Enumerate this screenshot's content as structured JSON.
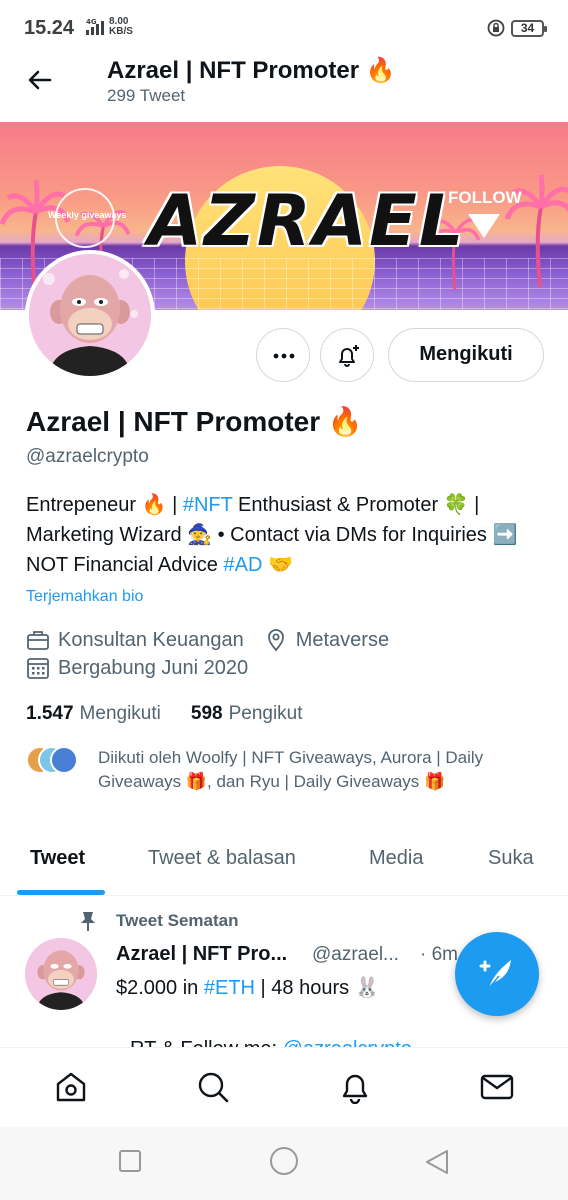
{
  "status_bar": {
    "time": "15.24",
    "network": "4G",
    "speed_value": "8.00",
    "speed_unit": "KB/S",
    "battery": "34"
  },
  "header": {
    "title": "Azrael | NFT Promoter 🔥",
    "tweet_count": "299 Tweet"
  },
  "banner": {
    "title": "AZRAEL",
    "badge_text": "Weekly giveaways",
    "follow_text": "FOLLOW"
  },
  "actions": {
    "follow_label": "Mengikuti"
  },
  "profile": {
    "name": "Azrael | NFT Promoter 🔥",
    "handle": "@azraelcrypto",
    "bio": {
      "line1_pre": "Entrepeneur 🔥 | ",
      "line1_tag": "#NFT",
      "line1_post": " Enthusiast & Promoter 🍀 | Marketing Wizard 🧙 • Contact via DMs for Inquiries ➡️ NOT Financial Advice ",
      "line1_tag2": "#AD",
      "line1_end": " 🤝"
    },
    "translate_label": "Terjemahkan bio",
    "category": "Konsultan Keuangan",
    "location": "Metaverse",
    "joined": "Bergabung Juni 2020",
    "following_count": "1.547",
    "following_label": "Mengikuti",
    "followers_count": "598",
    "followers_label": "Pengikut",
    "followed_by": "Diikuti oleh Woolfy | NFT Giveaways, Aurora | Daily Giveaways 🎁, dan Ryu | Daily Giveaways 🎁"
  },
  "tabs": [
    {
      "label": "Tweet",
      "active": true
    },
    {
      "label": "Tweet & balasan",
      "active": false
    },
    {
      "label": "Media",
      "active": false
    },
    {
      "label": "Suka",
      "active": false
    }
  ],
  "pinned_tweet": {
    "pinned_label": "Tweet Sematan",
    "name": "Azrael | NFT Pro...",
    "handle": "@azrael...",
    "time": "· 6m",
    "text_pre": "$2.000 in ",
    "text_tag": "#ETH",
    "text_post": " | 48 hours 🐰",
    "text2_pre": "RT & Follow me: ",
    "text2_tag": "@azraelcrypto"
  },
  "colors": {
    "accent": "#1d9bf0",
    "secondary_text": "#536471",
    "primary_text": "#0f1419"
  },
  "icons": {
    "back": "arrow-left-icon",
    "more": "more-horizontal-icon",
    "notify": "bell-plus-icon",
    "compose": "compose-tweet-icon",
    "nav": [
      "home-icon",
      "search-icon",
      "notifications-icon",
      "messages-icon"
    ],
    "system": [
      "recent-apps-icon",
      "home-circle-icon",
      "back-triangle-icon"
    ]
  }
}
